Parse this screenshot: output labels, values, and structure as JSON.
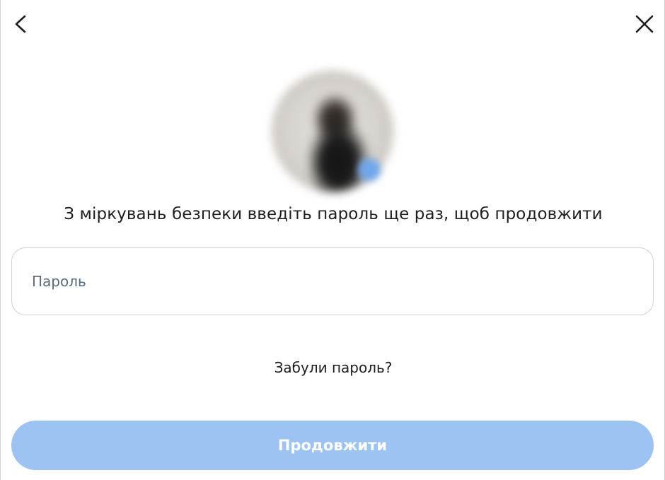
{
  "header": {
    "back_icon": "chevron-left-icon",
    "close_icon": "close-icon"
  },
  "profile": {
    "avatar_badge_color": "#6fa6ec"
  },
  "prompt_text": "З міркувань безпеки введіть пароль ще раз, щоб продовжити",
  "password_field": {
    "placeholder": "Пароль",
    "value": ""
  },
  "forgot_password_label": "Забули пароль?",
  "continue_button": {
    "label": "Продовжити",
    "disabled": true,
    "color": "#9cc3f2"
  }
}
